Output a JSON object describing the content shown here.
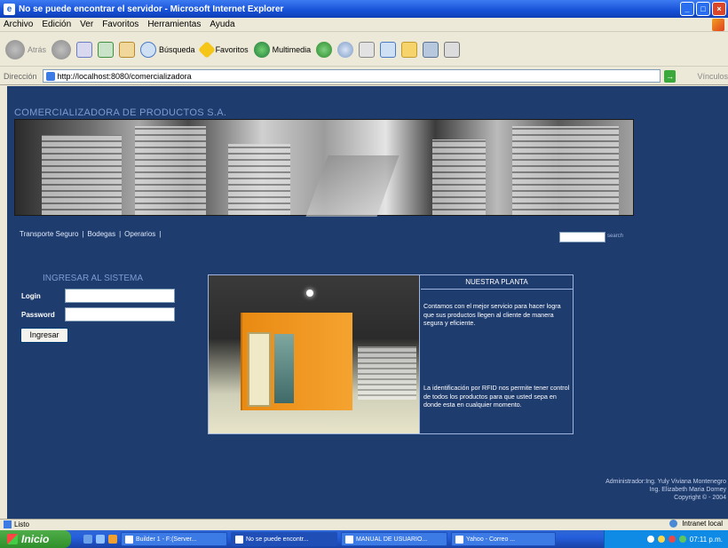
{
  "window": {
    "title": "No se puede encontrar el servidor - Microsoft Internet Explorer"
  },
  "menubar": {
    "items": [
      "Archivo",
      "Edición",
      "Ver",
      "Favoritos",
      "Herramientas",
      "Ayuda"
    ]
  },
  "toolbar": {
    "back": "Atrás",
    "search": "Búsqueda",
    "favorites": "Favoritos",
    "multimedia": "Multimedia"
  },
  "addressbar": {
    "label": "Dirección",
    "url": "http://localhost:8080/comercializadora",
    "links": "Vínculos"
  },
  "page": {
    "company": "COMERCIALIZADORA DE PRODUCTOS S.A.",
    "nav": [
      "Transporte Seguro",
      "Bodegas",
      "Operarios"
    ],
    "search_link": "search",
    "login": {
      "title": "INGRESAR AL SISTEMA",
      "login_label": "Login",
      "password_label": "Password",
      "button": "Ingresar"
    },
    "plant": {
      "header": "NUESTRA PLANTA",
      "paragraph1": "Contamos con el mejor servicio para hacer logra que sus productos llegen al cliente de manera segura y eficiente.",
      "paragraph2": "La identificación por RFID nos permite tener control de todos los productos para que usted sepa en donde esta en cualquier momento."
    },
    "footer": {
      "line1": "Administrador:Ing. Yuly Viviana Montenegro",
      "line2": "Ing. Elizabeth Maria Dorney",
      "line3": "Copyright © - 2004"
    }
  },
  "statusbar": {
    "left": "Listo",
    "zone": "Intranet local"
  },
  "taskbar": {
    "start": "Inicio",
    "tasks": [
      "Builder 1 - F:(Server...",
      "No se puede encontr...",
      "MANUAL DE USUARIO...",
      "Yahoo - Correo ..."
    ],
    "clock": "07:11 p.m."
  },
  "colors": {
    "page_background": "#1f3c6e",
    "heading_blue": "#7c9bd1",
    "title_bar": "#1650d6"
  }
}
